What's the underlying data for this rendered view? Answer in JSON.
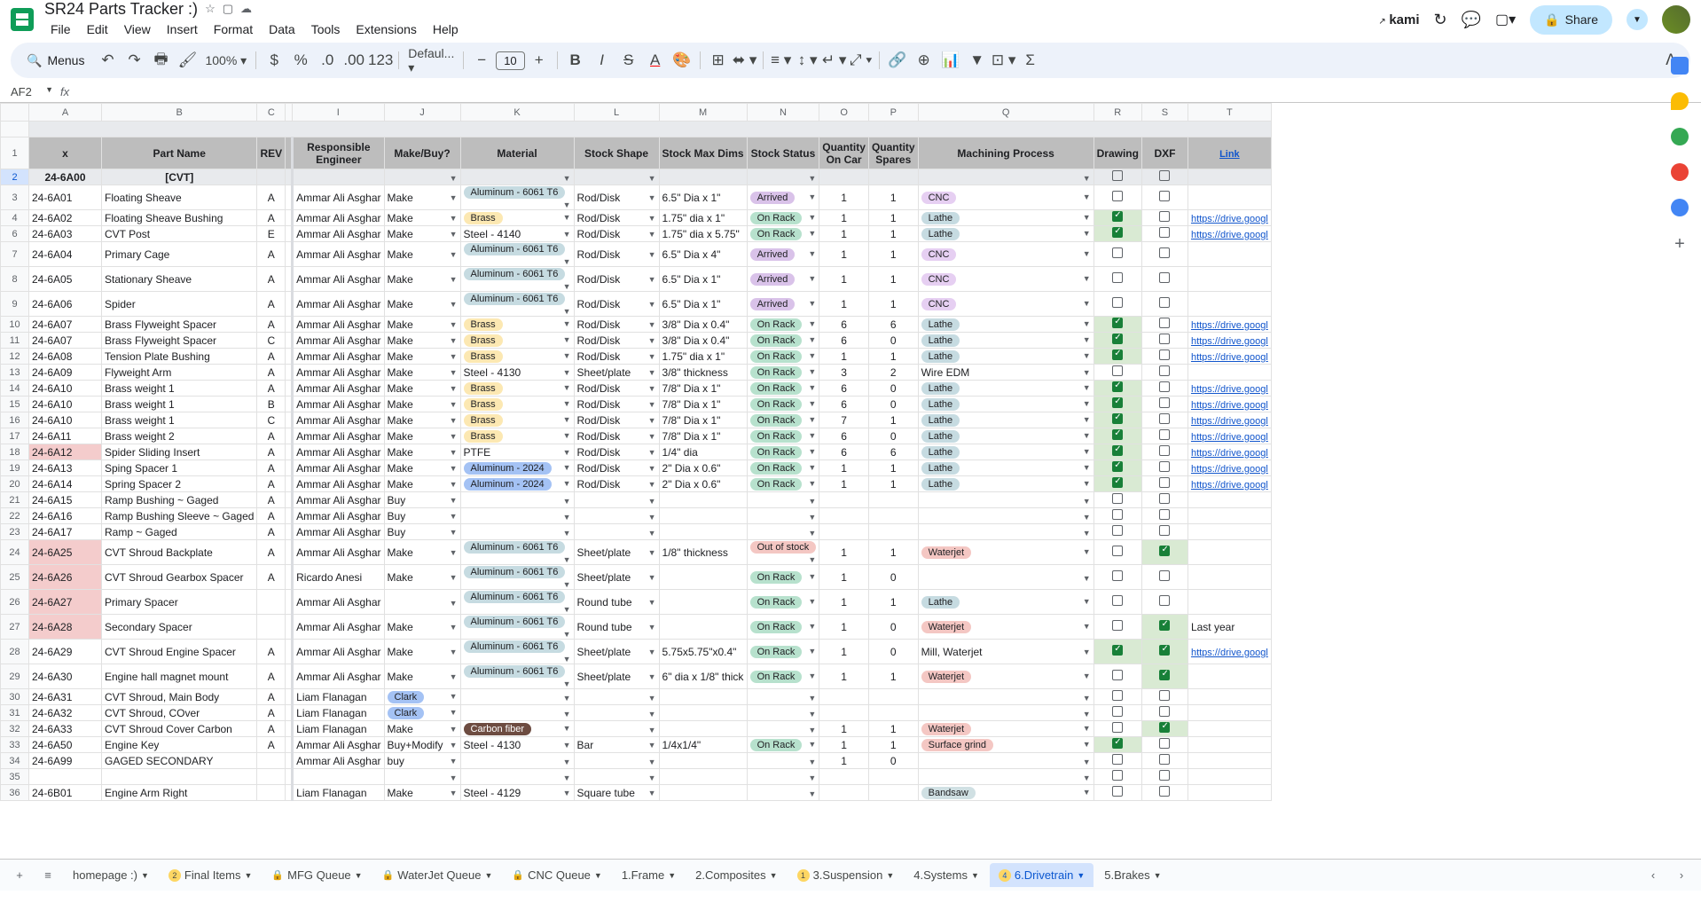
{
  "app": {
    "title": "SR24 Parts Tracker :)",
    "menus": [
      "File",
      "Edit",
      "View",
      "Insert",
      "Format",
      "Data",
      "Tools",
      "Extensions",
      "Help"
    ],
    "kami": "kami",
    "share": "Share"
  },
  "toolbar": {
    "menus": "Menus",
    "zoom": "100%",
    "currency": "$",
    "percent": "%",
    "font": "Defaul...",
    "fontsize": "10"
  },
  "namebox": "AF2",
  "headers": {
    "x": "x",
    "part": "Part Name",
    "rev": "REV",
    "eng": "Responsible Engineer",
    "mb": "Make/Buy?",
    "mat": "Material",
    "shape": "Stock Shape",
    "dims": "Stock Max Dims",
    "status": "Stock Status",
    "qcar": "Quantity On Car",
    "qsp": "Quantity Spares",
    "mach": "Machining Process",
    "drw": "Drawing",
    "dxf": "DXF",
    "link": "Link"
  },
  "cols": [
    "A",
    "B",
    "C",
    "",
    "I",
    "J",
    "K",
    "L",
    "M",
    "N",
    "O",
    "P",
    "Q",
    "R",
    "S",
    "T"
  ],
  "category": {
    "id": "24-6A00",
    "name": "[CVT]"
  },
  "linktext": "https://drive.googl",
  "lastyear": "Last year",
  "rows": [
    {
      "n": 3,
      "id": "24-6A01",
      "part": "Floating Sheave",
      "rev": "A",
      "eng": "Ammar Ali Asghar",
      "mb": "Make",
      "mat": "Aluminum - 6061 T6",
      "matc": "al",
      "shape": "Rod/Disk",
      "dims": "6.5\" Dia x 1\"",
      "stat": "Arrived",
      "statc": "arrived",
      "q1": 1,
      "q2": 1,
      "mach": "CNC",
      "machc": "cnc",
      "drw": false,
      "dxf": false,
      "link": ""
    },
    {
      "n": 4,
      "id": "24-6A02",
      "part": "Floating Sheave Bushing",
      "rev": "A",
      "eng": "Ammar Ali Asghar",
      "mb": "Make",
      "mat": "Brass",
      "matc": "brass",
      "shape": "Rod/Disk",
      "dims": "1.75\" dia x 1\"",
      "stat": "On Rack",
      "statc": "onrack",
      "q1": 1,
      "q2": 1,
      "mach": "Lathe",
      "machc": "lathe",
      "drw": true,
      "dxf": false,
      "link": "y"
    },
    {
      "n": 6,
      "id": "24-6A03",
      "part": "CVT Post",
      "rev": "E",
      "eng": "Ammar Ali Asghar",
      "mb": "Make",
      "mat": "Steel - 4140",
      "matc": "",
      "shape": "Rod/Disk",
      "dims": "1.75\" dia x 5.75\"",
      "stat": "On Rack",
      "statc": "onrack",
      "q1": 1,
      "q2": 1,
      "mach": "Lathe",
      "machc": "lathe",
      "drw": true,
      "dxf": false,
      "link": "y"
    },
    {
      "n": 7,
      "id": "24-6A04",
      "part": "Primary Cage",
      "rev": "A",
      "eng": "Ammar Ali Asghar",
      "mb": "Make",
      "mat": "Aluminum - 6061 T6",
      "matc": "al",
      "shape": "Rod/Disk",
      "dims": "6.5\" Dia x 4\"",
      "stat": "Arrived",
      "statc": "arrived",
      "q1": 1,
      "q2": 1,
      "mach": "CNC",
      "machc": "cnc",
      "drw": false,
      "dxf": false,
      "link": ""
    },
    {
      "n": 8,
      "id": "24-6A05",
      "part": "Stationary Sheave",
      "rev": "A",
      "eng": "Ammar Ali Asghar",
      "mb": "Make",
      "mat": "Aluminum - 6061 T6",
      "matc": "al",
      "shape": "Rod/Disk",
      "dims": "6.5\" Dia x 1\"",
      "stat": "Arrived",
      "statc": "arrived",
      "q1": 1,
      "q2": 1,
      "mach": "CNC",
      "machc": "cnc",
      "drw": false,
      "dxf": false,
      "link": ""
    },
    {
      "n": 9,
      "id": "24-6A06",
      "part": "Spider",
      "rev": "A",
      "eng": "Ammar Ali Asghar",
      "mb": "Make",
      "mat": "Aluminum - 6061 T6",
      "matc": "al",
      "shape": "Rod/Disk",
      "dims": "6.5\" Dia x 1\"",
      "stat": "Arrived",
      "statc": "arrived",
      "q1": 1,
      "q2": 1,
      "mach": "CNC",
      "machc": "cnc",
      "drw": false,
      "dxf": false,
      "link": ""
    },
    {
      "n": 10,
      "id": "24-6A07",
      "part": "Brass Flyweight Spacer",
      "rev": "A",
      "eng": "Ammar Ali Asghar",
      "mb": "Make",
      "mat": "Brass",
      "matc": "brass",
      "shape": "Rod/Disk",
      "dims": "3/8\" Dia x 0.4\"",
      "stat": "On Rack",
      "statc": "onrack",
      "q1": 6,
      "q2": 6,
      "mach": "Lathe",
      "machc": "lathe",
      "drw": true,
      "dxf": false,
      "link": "y"
    },
    {
      "n": 11,
      "id": "24-6A07",
      "part": "Brass Flyweight Spacer",
      "rev": "C",
      "eng": "Ammar Ali Asghar",
      "mb": "Make",
      "mat": "Brass",
      "matc": "brass",
      "shape": "Rod/Disk",
      "dims": "3/8\" Dia x 0.4\"",
      "stat": "On Rack",
      "statc": "onrack",
      "q1": 6,
      "q2": 0,
      "mach": "Lathe",
      "machc": "lathe",
      "drw": true,
      "dxf": false,
      "link": "y"
    },
    {
      "n": 12,
      "id": "24-6A08",
      "part": "Tension Plate Bushing",
      "rev": "A",
      "eng": "Ammar Ali Asghar",
      "mb": "Make",
      "mat": "Brass",
      "matc": "brass",
      "shape": "Rod/Disk",
      "dims": "1.75\" dia x 1\"",
      "stat": "On Rack",
      "statc": "onrack",
      "q1": 1,
      "q2": 1,
      "mach": "Lathe",
      "machc": "lathe",
      "drw": true,
      "dxf": false,
      "link": "y"
    },
    {
      "n": 13,
      "id": "24-6A09",
      "part": "Flyweight Arm",
      "rev": "A",
      "eng": "Ammar Ali Asghar",
      "mb": "Make",
      "mat": "Steel - 4130",
      "matc": "",
      "shape": "Sheet/plate",
      "dims": "3/8\" thickness",
      "stat": "On Rack",
      "statc": "onrack",
      "q1": 3,
      "q2": 2,
      "mach": "Wire EDM",
      "machc": "",
      "drw": false,
      "dxf": false,
      "link": ""
    },
    {
      "n": 14,
      "id": "24-6A10",
      "part": "Brass weight 1",
      "rev": "A",
      "eng": "Ammar Ali Asghar",
      "mb": "Make",
      "mat": "Brass",
      "matc": "brass",
      "shape": "Rod/Disk",
      "dims": "7/8\" Dia x 1\"",
      "stat": "On Rack",
      "statc": "onrack",
      "q1": 6,
      "q2": 0,
      "mach": "Lathe",
      "machc": "lathe",
      "drw": true,
      "dxf": false,
      "link": "y"
    },
    {
      "n": 15,
      "id": "24-6A10",
      "part": "Brass weight 1",
      "rev": "B",
      "eng": "Ammar Ali Asghar",
      "mb": "Make",
      "mat": "Brass",
      "matc": "brass",
      "shape": "Rod/Disk",
      "dims": "7/8\" Dia x 1\"",
      "stat": "On Rack",
      "statc": "onrack",
      "q1": 6,
      "q2": 0,
      "mach": "Lathe",
      "machc": "lathe",
      "drw": true,
      "dxf": false,
      "link": "y"
    },
    {
      "n": 16,
      "id": "24-6A10",
      "part": "Brass weight 1",
      "rev": "C",
      "eng": "Ammar Ali Asghar",
      "mb": "Make",
      "mat": "Brass",
      "matc": "brass",
      "shape": "Rod/Disk",
      "dims": "7/8\" Dia x 1\"",
      "stat": "On Rack",
      "statc": "onrack",
      "q1": 7,
      "q2": 1,
      "mach": "Lathe",
      "machc": "lathe",
      "drw": true,
      "dxf": false,
      "link": "y"
    },
    {
      "n": 17,
      "id": "24-6A11",
      "part": "Brass weight 2",
      "rev": "A",
      "eng": "Ammar Ali Asghar",
      "mb": "Make",
      "mat": "Brass",
      "matc": "brass",
      "shape": "Rod/Disk",
      "dims": "7/8\" Dia x 1\"",
      "stat": "On Rack",
      "statc": "onrack",
      "q1": 6,
      "q2": 0,
      "mach": "Lathe",
      "machc": "lathe",
      "drw": true,
      "dxf": false,
      "link": "y"
    },
    {
      "n": 18,
      "id": "24-6A12",
      "part": "Spider Sliding Insert",
      "rev": "A",
      "eng": "Ammar Ali Asghar",
      "mb": "Make",
      "mat": "PTFE",
      "matc": "",
      "shape": "Rod/Disk",
      "dims": "1/4\" dia",
      "stat": "On Rack",
      "statc": "onrack",
      "q1": 6,
      "q2": 6,
      "mach": "Lathe",
      "machc": "lathe",
      "drw": true,
      "dxf": false,
      "link": "y",
      "hl": "pink"
    },
    {
      "n": 19,
      "id": "24-6A13",
      "part": "Sping Spacer 1",
      "rev": "A",
      "eng": "Ammar Ali Asghar",
      "mb": "Make",
      "mat": "Aluminum - 2024",
      "matc": "al2",
      "shape": "Rod/Disk",
      "dims": "2\" Dia x 0.6\"",
      "stat": "On Rack",
      "statc": "onrack",
      "q1": 1,
      "q2": 1,
      "mach": "Lathe",
      "machc": "lathe",
      "drw": true,
      "dxf": false,
      "link": "y"
    },
    {
      "n": 20,
      "id": "24-6A14",
      "part": "Spring Spacer 2",
      "rev": "A",
      "eng": "Ammar Ali Asghar",
      "mb": "Make",
      "mat": "Aluminum - 2024",
      "matc": "al2",
      "shape": "Rod/Disk",
      "dims": "2\" Dia x 0.6\"",
      "stat": "On Rack",
      "statc": "onrack",
      "q1": 1,
      "q2": 1,
      "mach": "Lathe",
      "machc": "lathe",
      "drw": true,
      "dxf": false,
      "link": "y"
    },
    {
      "n": 21,
      "id": "24-6A15",
      "part": "Ramp Bushing ~ Gaged",
      "rev": "A",
      "eng": "Ammar Ali Asghar",
      "mb": "Buy",
      "mat": "",
      "matc": "",
      "shape": "",
      "dims": "",
      "stat": "",
      "statc": "",
      "q1": "",
      "q2": "",
      "mach": "",
      "machc": "",
      "drw": false,
      "dxf": false,
      "link": ""
    },
    {
      "n": 22,
      "id": "24-6A16",
      "part": "Ramp Bushing Sleeve ~ Gaged",
      "rev": "A",
      "eng": "Ammar Ali Asghar",
      "mb": "Buy",
      "mat": "",
      "matc": "",
      "shape": "",
      "dims": "",
      "stat": "",
      "statc": "",
      "q1": "",
      "q2": "",
      "mach": "",
      "machc": "",
      "drw": false,
      "dxf": false,
      "link": ""
    },
    {
      "n": 23,
      "id": "24-6A17",
      "part": "Ramp ~ Gaged",
      "rev": "A",
      "eng": "Ammar Ali Asghar",
      "mb": "Buy",
      "mat": "",
      "matc": "",
      "shape": "",
      "dims": "",
      "stat": "",
      "statc": "",
      "q1": "",
      "q2": "",
      "mach": "",
      "machc": "",
      "drw": false,
      "dxf": false,
      "link": ""
    },
    {
      "n": 24,
      "id": "24-6A25",
      "part": "CVT Shroud Backplate",
      "rev": "A",
      "eng": "Ammar Ali Asghar",
      "mb": "Make",
      "mat": "Aluminum - 6061 T6",
      "matc": "al",
      "shape": "Sheet/plate",
      "dims": "1/8\" thickness",
      "stat": "Out of stock",
      "statc": "oos",
      "q1": 1,
      "q2": 1,
      "mach": "Waterjet",
      "machc": "wj",
      "drw": false,
      "dxf": true,
      "link": "",
      "hl": "pink"
    },
    {
      "n": 25,
      "id": "24-6A26",
      "part": "CVT Shroud Gearbox Spacer",
      "rev": "A",
      "eng": "Ricardo Anesi",
      "mb": "Make",
      "mat": "Aluminum - 6061 T6",
      "matc": "al",
      "shape": "Sheet/plate",
      "dims": "",
      "stat": "On Rack",
      "statc": "onrack",
      "q1": 1,
      "q2": 0,
      "mach": "",
      "machc": "",
      "drw": false,
      "dxf": false,
      "link": "",
      "hl": "pink"
    },
    {
      "n": 26,
      "id": "24-6A27",
      "part": "Primary Spacer",
      "rev": "",
      "eng": "Ammar Ali Asghar",
      "mb": "",
      "mat": "Aluminum - 6061 T6",
      "matc": "al",
      "shape": "Round tube",
      "dims": "",
      "stat": "On Rack",
      "statc": "onrack",
      "q1": 1,
      "q2": 1,
      "mach": "Lathe",
      "machc": "lathe",
      "drw": false,
      "dxf": false,
      "link": "",
      "hl": "pink"
    },
    {
      "n": 27,
      "id": "24-6A28",
      "part": "Secondary Spacer",
      "rev": "",
      "eng": "Ammar Ali Asghar",
      "mb": "Make",
      "mat": "Aluminum - 6061 T6",
      "matc": "al",
      "shape": "Round tube",
      "dims": "",
      "stat": "On Rack",
      "statc": "onrack",
      "q1": 1,
      "q2": 0,
      "mach": "Waterjet",
      "machc": "wj",
      "drw": false,
      "dxf": true,
      "link": "ly",
      "hl": "pink"
    },
    {
      "n": 28,
      "id": "24-6A29",
      "part": "CVT Shroud Engine Spacer",
      "rev": "A",
      "eng": "Ammar Ali Asghar",
      "mb": "Make",
      "mat": "Aluminum - 6061 T6",
      "matc": "al",
      "shape": "Sheet/plate",
      "dims": "5.75x5.75\"x0.4\"",
      "stat": "On Rack",
      "statc": "onrack",
      "q1": 1,
      "q2": 0,
      "mach": "Mill, Waterjet",
      "machc": "",
      "drw": true,
      "dxf": true,
      "link": "y"
    },
    {
      "n": 29,
      "id": "24-6A30",
      "part": "Engine hall magnet mount",
      "rev": "A",
      "eng": "Ammar Ali Asghar",
      "mb": "Make",
      "mat": "Aluminum - 6061 T6",
      "matc": "al",
      "shape": "Sheet/plate",
      "dims": "6\" dia x 1/8\" thick",
      "stat": "On Rack",
      "statc": "onrack",
      "q1": 1,
      "q2": 1,
      "mach": "Waterjet",
      "machc": "wj",
      "drw": false,
      "dxf": true,
      "link": ""
    },
    {
      "n": 30,
      "id": "24-6A31",
      "part": "CVT Shroud, Main Body",
      "rev": "A",
      "eng": "Liam Flanagan",
      "mb": "Clark",
      "mbc": "clark",
      "mat": "",
      "matc": "",
      "shape": "",
      "dims": "",
      "stat": "",
      "statc": "",
      "q1": "",
      "q2": "",
      "mach": "",
      "machc": "",
      "drw": false,
      "dxf": false,
      "link": ""
    },
    {
      "n": 31,
      "id": "24-6A32",
      "part": "CVT Shroud, COver",
      "rev": "A",
      "eng": "Liam Flanagan",
      "mb": "Clark",
      "mbc": "clark",
      "mat": "",
      "matc": "",
      "shape": "",
      "dims": "",
      "stat": "",
      "statc": "",
      "q1": "",
      "q2": "",
      "mach": "",
      "machc": "",
      "drw": false,
      "dxf": false,
      "link": ""
    },
    {
      "n": 32,
      "id": "24-6A33",
      "part": "   CVT Shroud Cover Carbon",
      "rev": "A",
      "eng": "Liam Flanagan",
      "mb": "Make",
      "mat": "Carbon fiber",
      "matc": "carbon",
      "shape": "",
      "dims": "",
      "stat": "",
      "statc": "",
      "q1": 1,
      "q2": 1,
      "mach": "Waterjet",
      "machc": "wj",
      "drw": false,
      "dxf": true,
      "link": ""
    },
    {
      "n": 33,
      "id": "24-6A50",
      "part": "Engine Key",
      "rev": "A",
      "eng": "Ammar Ali Asghar",
      "mb": "Buy+Modify",
      "mat": "Steel - 4130",
      "matc": "",
      "shape": "Bar",
      "dims": "1/4x1/4\"",
      "stat": "On Rack",
      "statc": "onrack",
      "q1": 1,
      "q2": 1,
      "mach": "Surface grind",
      "machc": "sg",
      "drw": true,
      "dxf": false,
      "link": ""
    },
    {
      "n": 34,
      "id": "24-6A99",
      "part": "GAGED SECONDARY",
      "rev": "",
      "eng": "Ammar Ali Asghar",
      "mb": "buy",
      "mat": "",
      "matc": "",
      "shape": "",
      "dims": "",
      "stat": "",
      "statc": "",
      "q1": 1,
      "q2": 0,
      "mach": "",
      "machc": "",
      "drw": false,
      "dxf": false,
      "link": ""
    },
    {
      "n": 35,
      "id": "",
      "part": "",
      "rev": "",
      "eng": "",
      "mb": "",
      "mat": "",
      "matc": "",
      "shape": "",
      "dims": "",
      "stat": "",
      "statc": "",
      "q1": "",
      "q2": "",
      "mach": "",
      "machc": "",
      "drw": false,
      "dxf": false,
      "link": ""
    },
    {
      "n": 36,
      "id": "24-6B01",
      "part": "Engine Arm Right",
      "rev": "",
      "eng": "Liam Flanagan",
      "mb": "Make",
      "mat": "Steel - 4129",
      "matc": "",
      "shape": "Square tube",
      "dims": "",
      "stat": "",
      "statc": "",
      "q1": "",
      "q2": "",
      "mach": "Bandsaw",
      "machc": "band",
      "drw": false,
      "dxf": false,
      "link": ""
    }
  ],
  "tabs": [
    {
      "label": "homepage :)",
      "badge": ""
    },
    {
      "label": "Final Items",
      "badge": "2"
    },
    {
      "label": "MFG Queue",
      "lock": true
    },
    {
      "label": "WaterJet Queue",
      "lock": true
    },
    {
      "label": "CNC Queue",
      "lock": true
    },
    {
      "label": "1.Frame"
    },
    {
      "label": "2.Composites"
    },
    {
      "label": "3.Suspension",
      "badge": "1"
    },
    {
      "label": "4.Systems"
    },
    {
      "label": "6.Drivetrain",
      "badge": "4",
      "active": true
    },
    {
      "label": "5.Brakes"
    }
  ]
}
